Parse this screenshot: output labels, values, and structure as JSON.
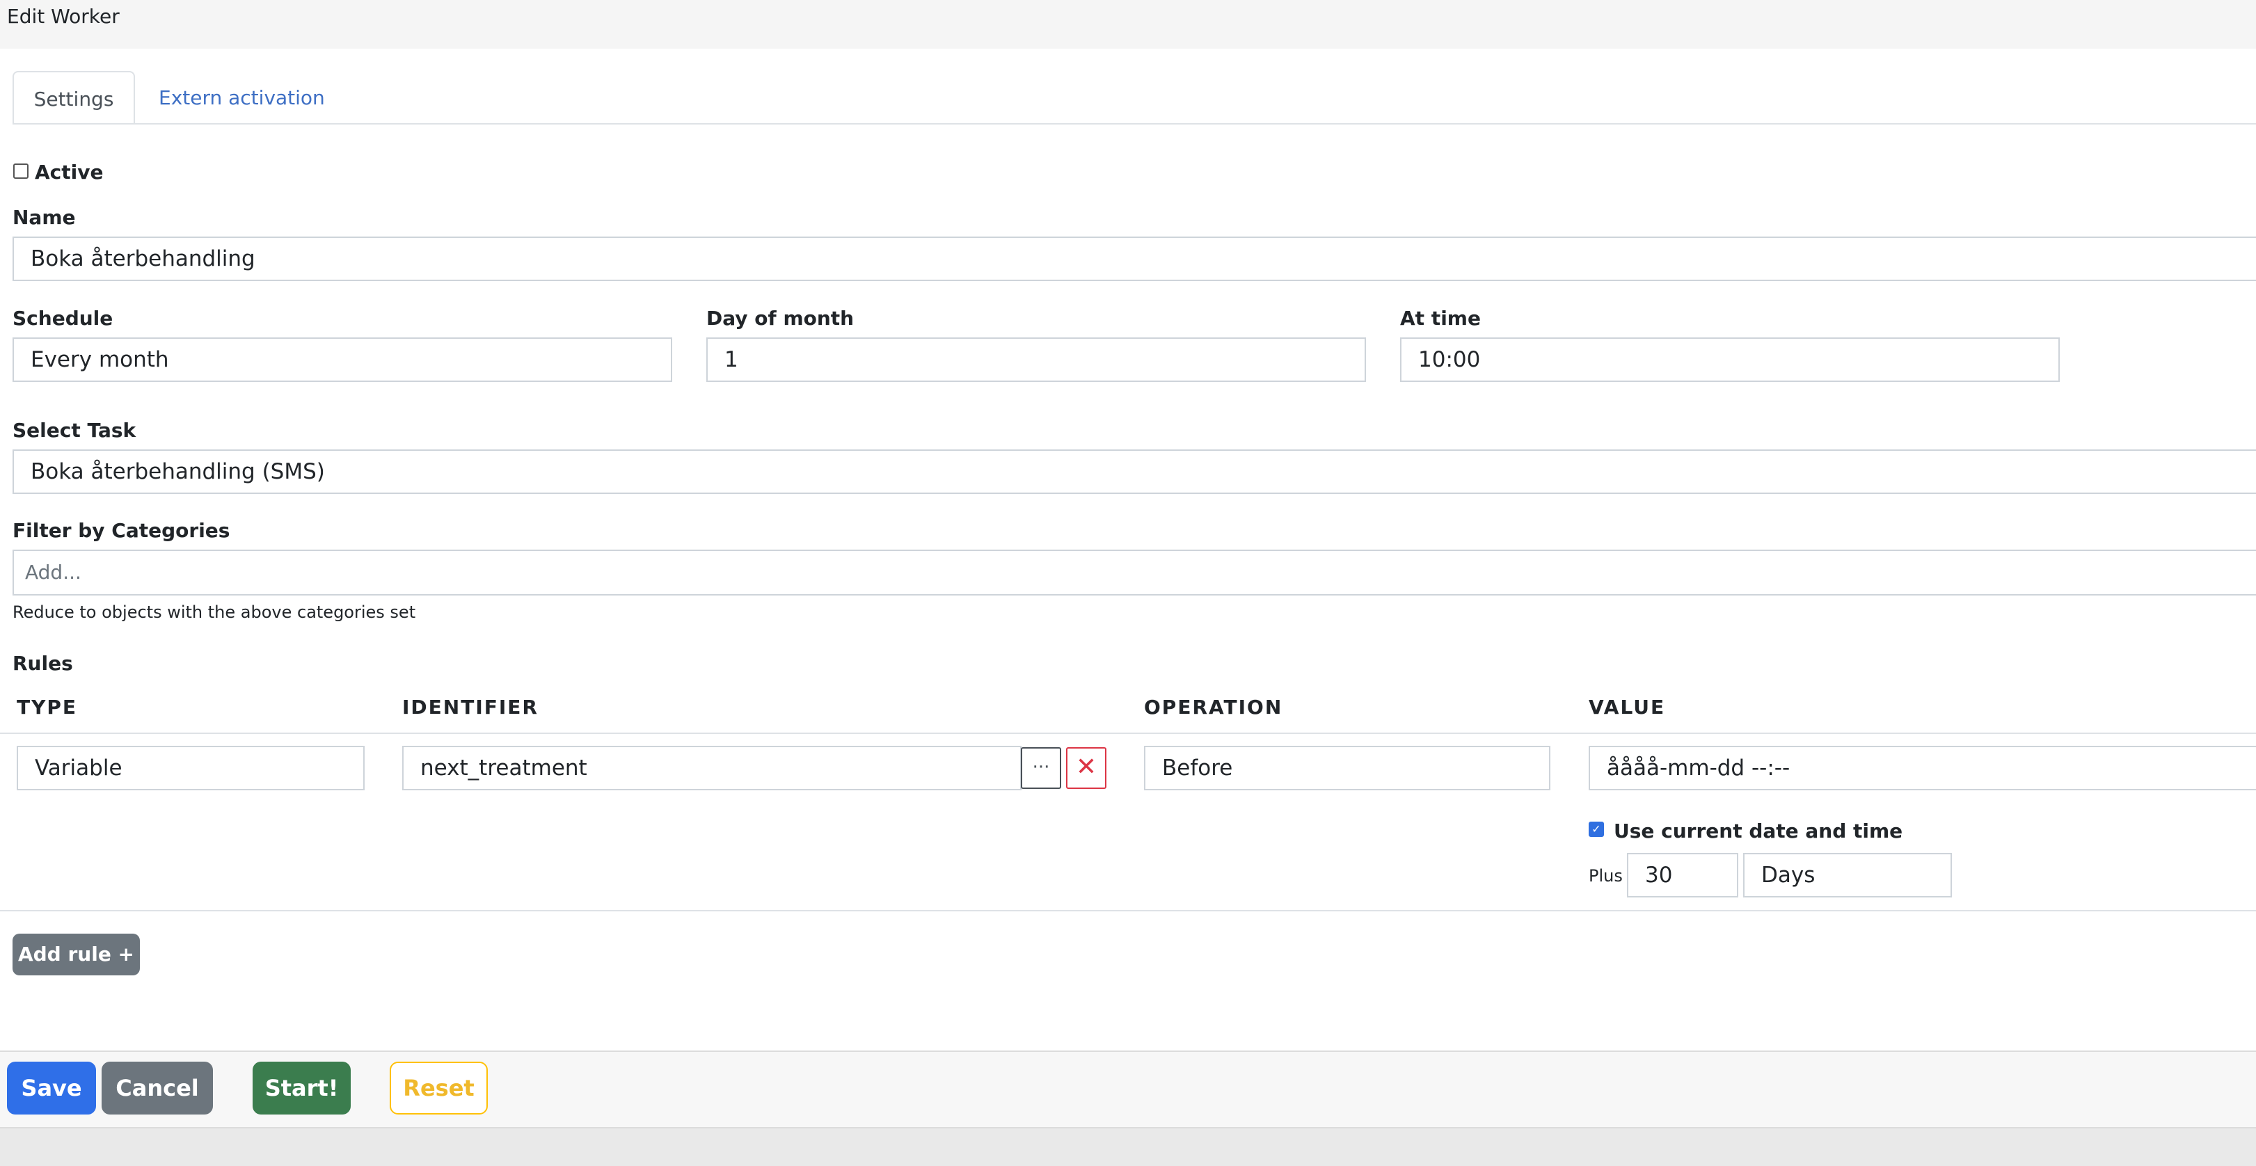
{
  "window": {
    "title": "Edit Worker"
  },
  "tabs": [
    {
      "label": "Settings",
      "active": true
    },
    {
      "label": "Extern activation",
      "active": false
    }
  ],
  "active": {
    "label": "Active",
    "checked": false
  },
  "name": {
    "label": "Name",
    "value": "Boka återbehandling"
  },
  "schedule": {
    "label": "Schedule",
    "value": "Every month",
    "day_label": "Day of month",
    "day_value": "1",
    "time_label": "At time",
    "time_value": "10:00"
  },
  "task": {
    "label": "Select Task",
    "value": "Boka återbehandling (SMS)"
  },
  "categories": {
    "label": "Filter by Categories",
    "placeholder": "Add...",
    "help": "Reduce to objects with the above categories set"
  },
  "rules": {
    "title": "Rules",
    "headers": [
      "TYPE",
      "IDENTIFIER",
      "OPERATION",
      "VALUE"
    ],
    "rows": [
      {
        "type": "Variable",
        "identifier": "next_treatment",
        "more_icon": "···",
        "delete_icon": "✕",
        "operation": "Before",
        "value": "åååå-mm-dd --:--",
        "use_current_label": "Use current date and time",
        "use_current_checked": true,
        "plus_label": "Plus",
        "plus_value": "30",
        "plus_unit": "Days"
      }
    ],
    "add_label": "Add rule +"
  },
  "footer": {
    "save": "Save",
    "cancel": "Cancel",
    "start": "Start!",
    "reset": "Reset"
  },
  "colors": {
    "primary": "#2f6fe8",
    "secondary": "#6c757d",
    "success": "#3b7d4e",
    "warning": "#ffc107",
    "danger": "#dc3545",
    "link": "#3e6fc4"
  }
}
